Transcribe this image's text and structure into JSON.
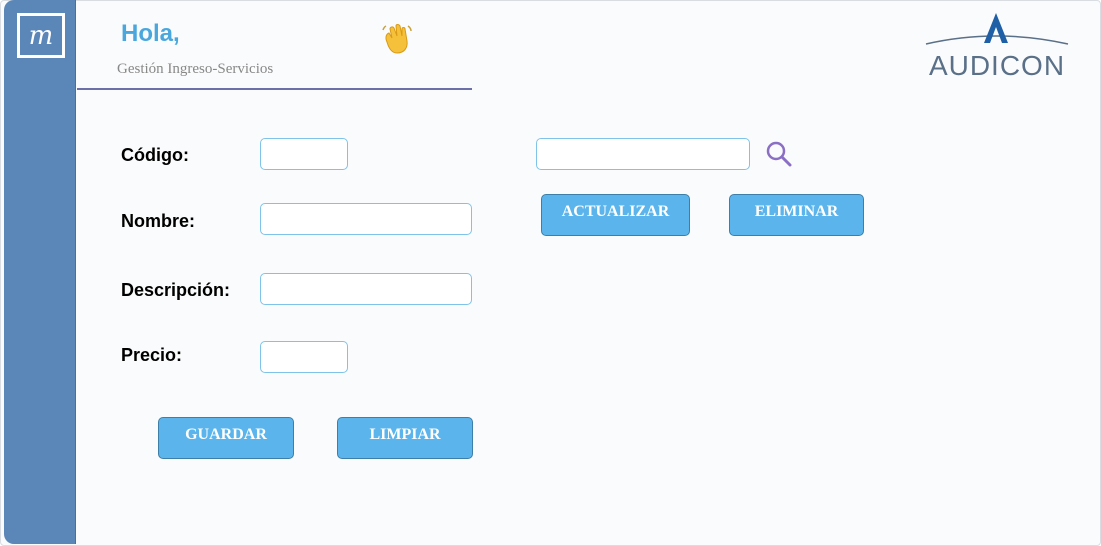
{
  "sidebar": {
    "logo_letter": "m"
  },
  "header": {
    "greeting": "Hola,",
    "subtitle": "Gestión Ingreso-Servicios",
    "brand": "AUDICON"
  },
  "form": {
    "codigo_label": "Código:",
    "codigo_value": "",
    "nombre_label": "Nombre:",
    "nombre_value": "",
    "descripcion_label": "Descripción:",
    "descripcion_value": "",
    "precio_label": "Precio:",
    "precio_value": "",
    "search_value": ""
  },
  "buttons": {
    "actualizar": "ACTUALIZAR",
    "eliminar": "ELIMINAR",
    "guardar": "GUARDAR",
    "limpiar": "LIMPIAR"
  },
  "colors": {
    "sidebar": "#5b86b8",
    "accent": "#4aa7de",
    "button": "#5bb5ec"
  }
}
